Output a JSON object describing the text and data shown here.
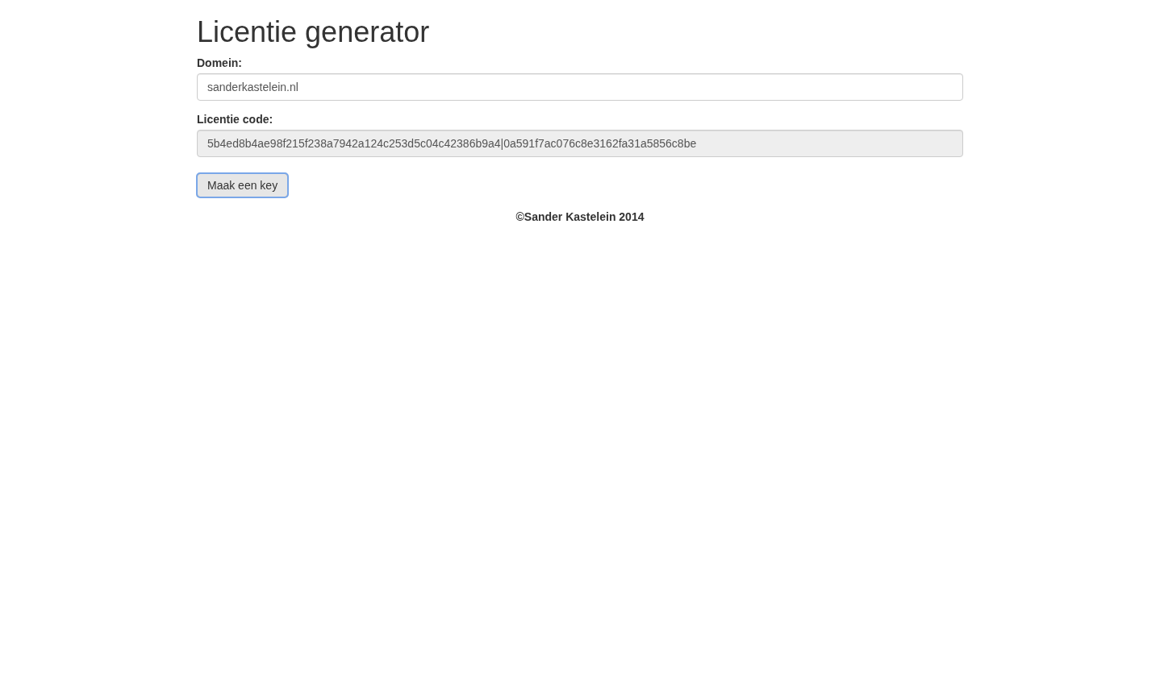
{
  "title": "Licentie generator",
  "fields": [
    {
      "label": "Domein:",
      "value": "sanderkastelein.nl",
      "disabled": false
    },
    {
      "label": "Licentie code:",
      "value": "5b4ed8b4ae98f215f238a7942a124c253d5c04c42386b9a4|0a591f7ac076c8e3162fa31a5856c8be",
      "disabled": true
    }
  ],
  "button": {
    "label": "Maak een key",
    "focused": true
  },
  "footer": "©Sander Kastelein 2014"
}
